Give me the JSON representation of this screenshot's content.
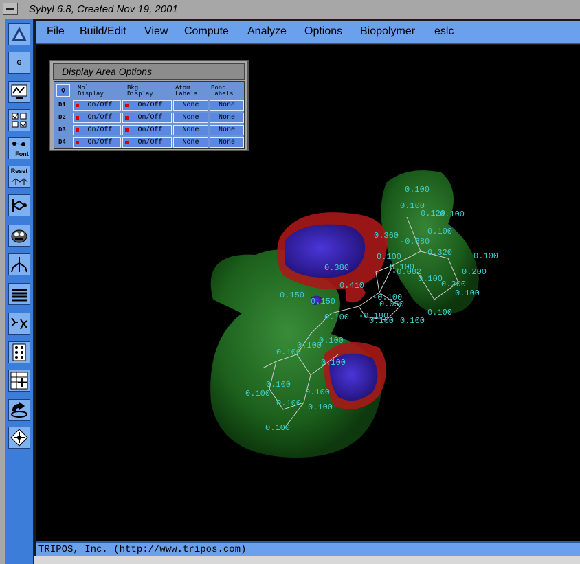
{
  "window": {
    "title": "Sybyl 6.8, Created Nov 19, 2001"
  },
  "menubar": {
    "items": [
      "File",
      "Build/Edit",
      "View",
      "Compute",
      "Analyze",
      "Options",
      "Biopolymer",
      "eslc"
    ]
  },
  "toolbar": {
    "buttons": [
      {
        "name": "sybyl-logo-button",
        "label": "▲"
      },
      {
        "name": "g-button",
        "label": "G"
      },
      {
        "name": "monitor-graph-button",
        "label": ""
      },
      {
        "name": "checkbox-grid-button",
        "label": ""
      },
      {
        "name": "font-button",
        "label": "Font"
      },
      {
        "name": "reset-button",
        "label": "Reset"
      },
      {
        "name": "rotate-molecule-button",
        "label": ""
      },
      {
        "name": "camera-button",
        "label": ""
      },
      {
        "name": "molecule-structure-button",
        "label": ""
      },
      {
        "name": "layers-button",
        "label": ""
      },
      {
        "name": "molecule-pair-button",
        "label": ""
      },
      {
        "name": "grid-dots-button",
        "label": ""
      },
      {
        "name": "table-view-button",
        "label": ""
      },
      {
        "name": "undo-arrow-button",
        "label": ""
      },
      {
        "name": "transform-button",
        "label": ""
      }
    ]
  },
  "dialog": {
    "title": "Display Area Options",
    "q_label": "Q",
    "headers": [
      [
        "Mol",
        "Display"
      ],
      [
        "Bkg",
        "Display"
      ],
      [
        "Atom",
        "Labels"
      ],
      [
        "Bond",
        "Labels"
      ]
    ],
    "rows": [
      {
        "id": "D1",
        "mol": "On/Off",
        "bkg": "On/Off",
        "atom": "None",
        "bond": "None"
      },
      {
        "id": "D2",
        "mol": "On/Off",
        "bkg": "On/Off",
        "atom": "None",
        "bond": "None"
      },
      {
        "id": "D3",
        "mol": "On/Off",
        "bkg": "On/Off",
        "atom": "None",
        "bond": "None"
      },
      {
        "id": "D4",
        "mol": "On/Off",
        "bkg": "On/Off",
        "atom": "None",
        "bond": "None"
      }
    ]
  },
  "viewport": {
    "atom_labels": [
      "0.100",
      "0.100",
      "0.120",
      "0.100",
      "0.100",
      "0.360",
      "-0.680",
      "0.320",
      "0.100",
      "0.100",
      "0.100",
      "-0.082",
      "0.200",
      "0.100",
      "0.200",
      "0.380",
      "0.410",
      "0.100",
      "-0.100",
      "0.050",
      "0.150",
      "0.150",
      "0.100",
      "0.100",
      "-0.180",
      "0.100",
      "0.100",
      "0.100",
      "0.100",
      "0.100",
      "0.100",
      "0.100",
      "0.100",
      "0.100",
      "0.100",
      "0.100",
      "0.100"
    ]
  },
  "statusbar": {
    "text": "TRIPOS, Inc. (http://www.tripos.com)"
  },
  "colors": {
    "toolbar": "#3b7dd8",
    "menubar": "#6aa0ec",
    "green_surface": "#2e7d2e",
    "red_surface": "#b01818",
    "blue_surface": "#3020a8",
    "label": "#40d0d0"
  }
}
